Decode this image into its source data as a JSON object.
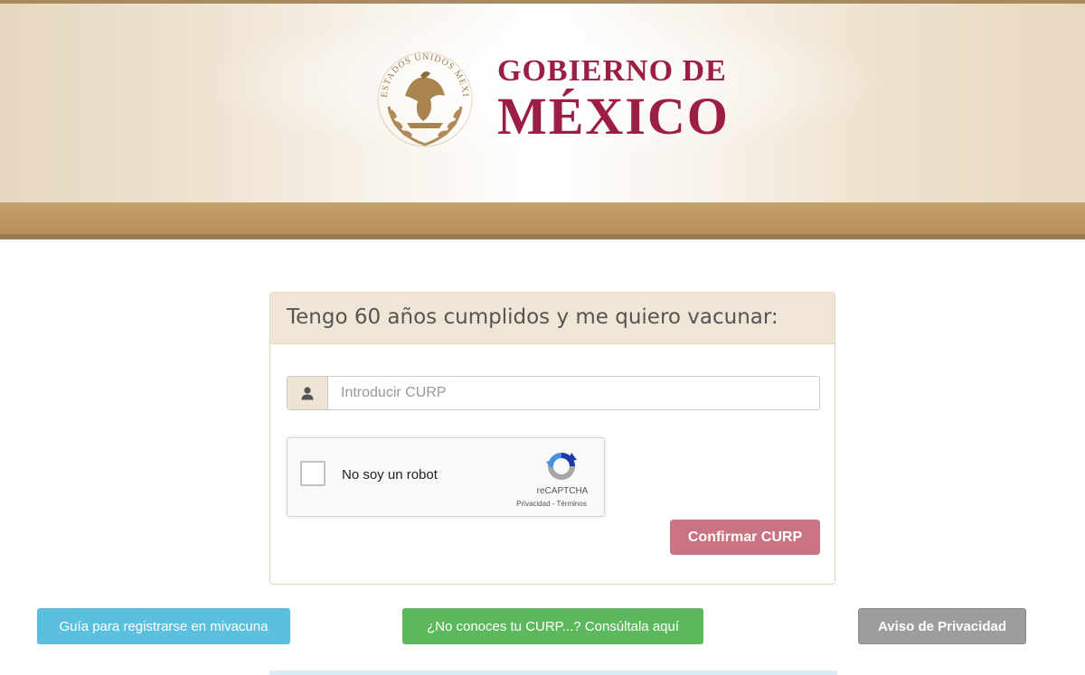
{
  "header": {
    "brand_line1": "GOBIERNO DE",
    "brand_line2": "MÉXICO",
    "seal_icon": "estados-unidos-mexicanos-seal-icon",
    "seal_text": "ESTADOS UNIDOS MEXICANOS",
    "colors": {
      "brand": "#9b1f45",
      "band": "#b78f5a"
    }
  },
  "card": {
    "title": "Tengo 60 años cumplidos y me quiero vacunar:",
    "curp_input": {
      "value": "",
      "placeholder": "Introducir CURP",
      "icon": "user-icon"
    },
    "recaptcha": {
      "label": "No soy un robot",
      "brand": "reCAPTCHA",
      "links": "Privacidad - Términos",
      "checked": false
    },
    "confirm_label": "Confirmar CURP"
  },
  "buttons": {
    "guide": "Guía para registrarse en mivacuna",
    "curp_lookup": "¿No conoces tu CURP...? Consúltala aquí",
    "privacy": "Aviso de Privacidad"
  },
  "colors": {
    "confirm": "#c97383",
    "info": "#5bc0de",
    "success": "#5cb85c",
    "neutral": "#9d9d9d"
  }
}
